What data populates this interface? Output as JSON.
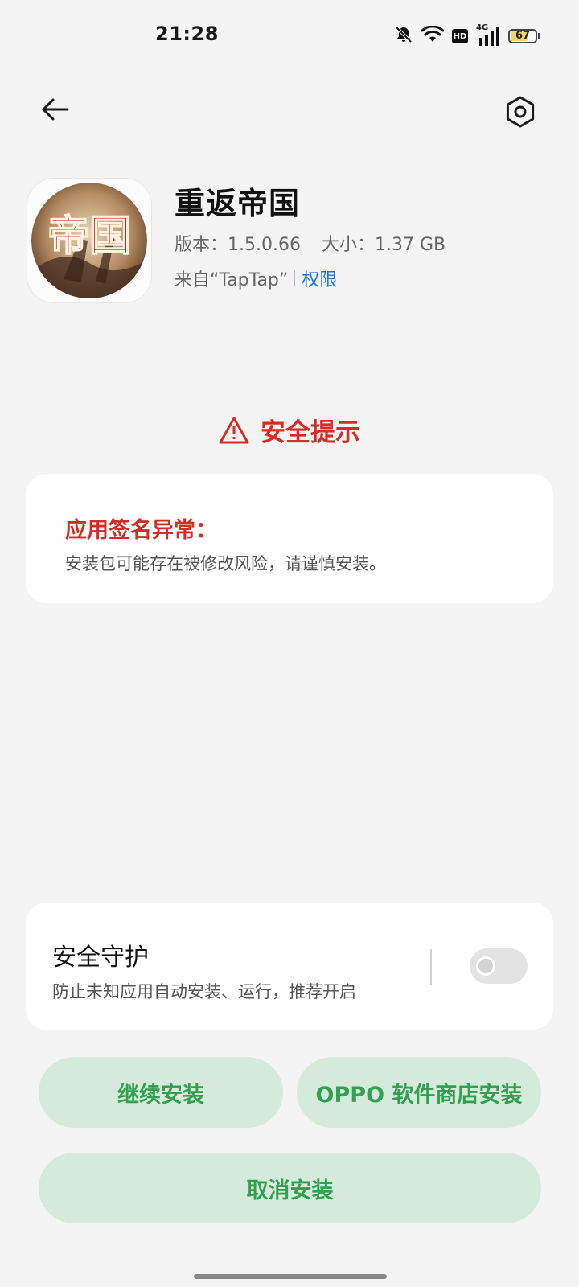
{
  "status_bar": {
    "time": "21:28",
    "icons": [
      "bell-muted-icon",
      "wifi-icon",
      "hd-icon",
      "cell-signal-4g-icon",
      "battery-icon"
    ],
    "hd_label": "HD",
    "network_label": "4G",
    "battery_level": "67"
  },
  "header": {
    "back_icon": "arrow-left-icon",
    "settings_icon": "hexagon-gear-icon"
  },
  "app": {
    "name": "重返帝国",
    "version": "版本：1.5.0.66",
    "size": "大小：1.37 GB",
    "source": "来自“TapTap”",
    "permissions_link": "权限",
    "icon_text": "帝国"
  },
  "security": {
    "title": "安全提示",
    "card_title": "应用签名异常：",
    "card_desc": "安装包可能存在被修改风险，请谨慎安装。"
  },
  "protection": {
    "title": "安全守护",
    "desc": "防止未知应用自动安装、运行，推荐开启",
    "toggle_on": false
  },
  "buttons": {
    "continue": "继续安装",
    "store_install": "OPPO 软件商店安装",
    "cancel": "取消安装"
  },
  "colors": {
    "danger": "#d62c25",
    "accent_text": "#32a04f",
    "accent_bg": "#d6eadc",
    "link": "#1f73d8",
    "background": "#f4f4f4"
  }
}
